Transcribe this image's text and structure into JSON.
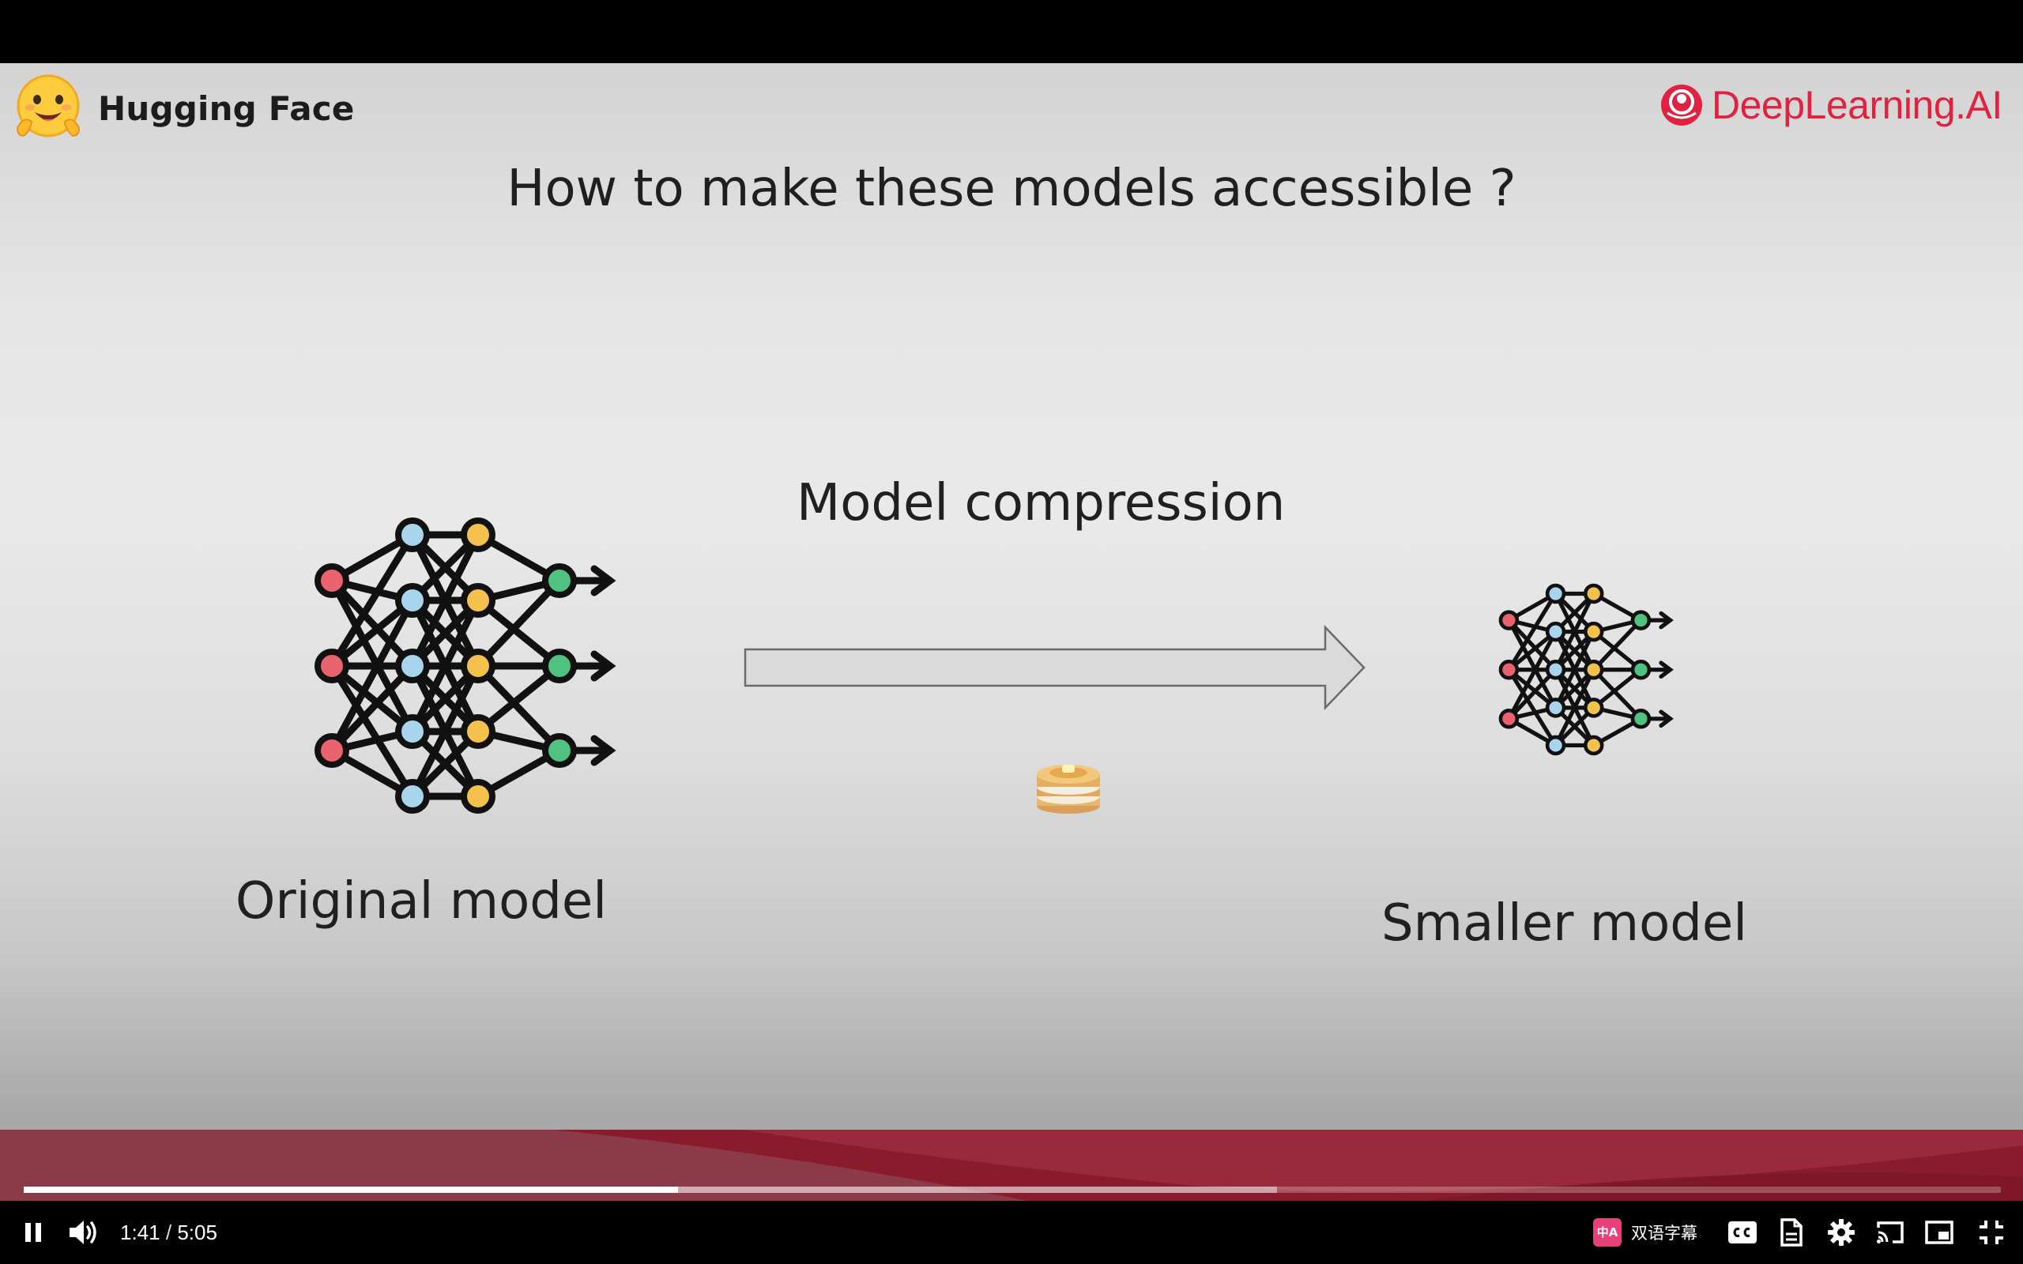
{
  "slide": {
    "brand_left": "Hugging Face",
    "brand_right": "DeepLearning.AI",
    "title": "How to make these models accessible ?",
    "compression_label": "Model compression",
    "original_label": "Original model",
    "smaller_label": "Smaller model",
    "icons": [
      "hugging-face-emoji",
      "deeplearning-ai-logo",
      "neural-network-icon",
      "arrow-right",
      "pancakes-emoji"
    ],
    "colors": {
      "brand_red": "#e0213f",
      "node_red": "#e8636e",
      "node_blue": "#a9d4ee",
      "node_yellow": "#f3c14c",
      "node_green": "#4fc27f",
      "band": "#8a1b2c"
    }
  },
  "player": {
    "current_time": "1:41",
    "separator": "/",
    "duration": "5:05",
    "played_fraction": 0.331,
    "buffered_fraction": 0.634,
    "subtitle_plugin_label": "双语字幕",
    "subtitle_badge": "中A",
    "controls": [
      "pause",
      "volume",
      "closed-captions",
      "transcript",
      "settings",
      "cast",
      "miniplayer",
      "exit-fullscreen"
    ]
  }
}
